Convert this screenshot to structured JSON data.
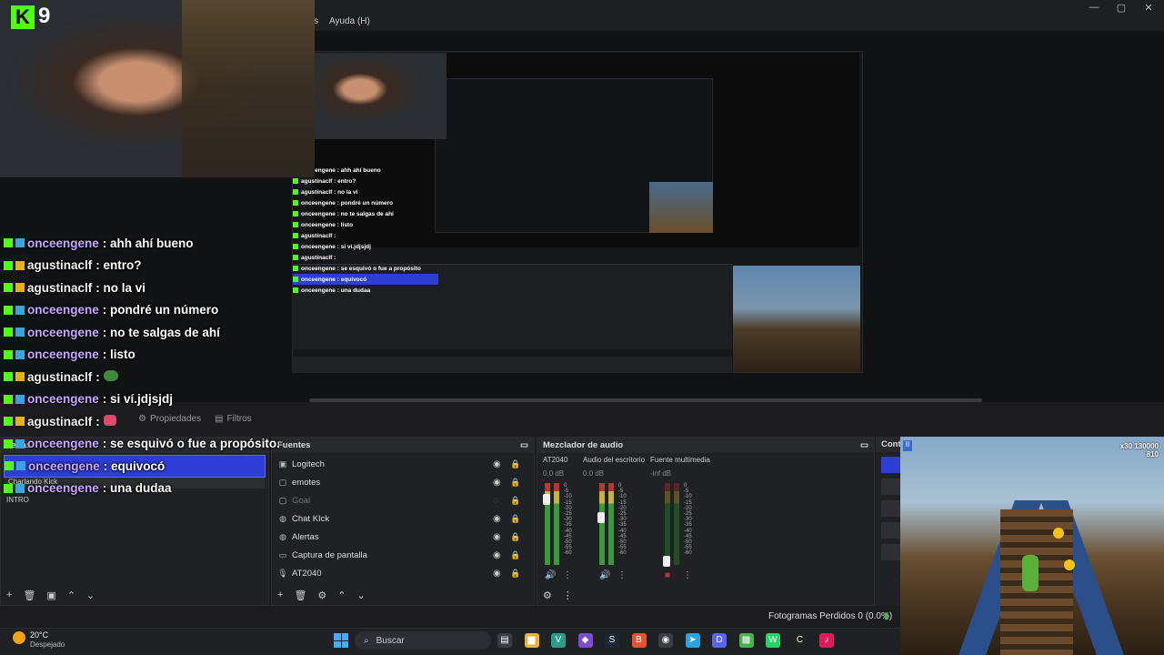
{
  "window": {
    "menu_help": "Ayuda (H)",
    "menu_partial": "s",
    "controls": [
      "—",
      "▢",
      "✕"
    ]
  },
  "overlay": {
    "kick_badge": "K",
    "viewer_count": "9"
  },
  "chat": [
    {
      "user": "onceengene",
      "message": "ahh ahí bueno",
      "badge": "sub",
      "highlight": false
    },
    {
      "user": "agustinaclf",
      "message": "entro?",
      "badge": "crown",
      "highlight": false
    },
    {
      "user": "agustinaclf",
      "message": "no la vi",
      "badge": "crown",
      "highlight": false
    },
    {
      "user": "onceengene",
      "message": "pondré un número",
      "badge": "sub",
      "highlight": false
    },
    {
      "user": "onceengene",
      "message": "no te salgas de ahí",
      "badge": "sub",
      "highlight": false
    },
    {
      "user": "onceengene",
      "message": "listo",
      "badge": "sub",
      "highlight": false
    },
    {
      "user": "agustinaclf",
      "message": "",
      "badge": "crown",
      "highlight": false
    },
    {
      "user": "onceengene",
      "message": "si ví.jdjsjdj",
      "badge": "sub",
      "highlight": false
    },
    {
      "user": "agustinaclf",
      "message": "",
      "badge": "crown",
      "highlight": false
    },
    {
      "user": "onceengene",
      "message": "se esquivó o fue a propósito.",
      "badge": "sub",
      "highlight": false
    },
    {
      "user": "onceengene",
      "message": "equivocó",
      "badge": "sub",
      "highlight": true
    },
    {
      "user": "onceengene",
      "message": "una dudaa",
      "badge": "sub",
      "highlight": false
    }
  ],
  "preview_chat": [
    {
      "text": "onceengene : ahh ahí bueno",
      "highlight": false
    },
    {
      "text": "agustinaclf : entro?",
      "highlight": false
    },
    {
      "text": "agustinaclf : no la vi",
      "highlight": false
    },
    {
      "text": "onceengene : pondré un número",
      "highlight": false
    },
    {
      "text": "onceengene : no te salgas de ahí",
      "highlight": false
    },
    {
      "text": "onceengene : listo",
      "highlight": false
    },
    {
      "text": "agustinaclf :",
      "highlight": false
    },
    {
      "text": "onceengene : si ví.jdjsjdj",
      "highlight": false
    },
    {
      "text": "agustinaclf :",
      "highlight": false
    },
    {
      "text": "onceengene : se esquivó o fue a propósito",
      "highlight": false
    },
    {
      "text": "onceengene : equivocó",
      "highlight": true
    },
    {
      "text": "onceengene : una dudaa",
      "highlight": false
    }
  ],
  "dock_tabs": {
    "properties": "Propiedades",
    "filters": "Filtros"
  },
  "scenes": {
    "title_partial": "cenas",
    "items": [
      "Charlando Kick",
      "INTRO"
    ],
    "footer_buttons": [
      "+",
      "🗑",
      "▣",
      "⌃",
      "⌄"
    ]
  },
  "sources": {
    "title": "Fuentes",
    "items": [
      {
        "name": "Logitech",
        "icon": "camera-icon",
        "glyph": "▣",
        "visible": true
      },
      {
        "name": "emotes",
        "icon": "window-icon",
        "glyph": "▢",
        "visible": true
      },
      {
        "name": "Goal",
        "icon": "window-icon",
        "glyph": "▢",
        "visible": false
      },
      {
        "name": "Chat KIck",
        "icon": "browser-icon",
        "glyph": "◍",
        "visible": true
      },
      {
        "name": "Alertas",
        "icon": "browser-icon",
        "glyph": "◍",
        "visible": true
      },
      {
        "name": "Captura de pantalla",
        "icon": "monitor-icon",
        "glyph": "▭",
        "visible": true
      },
      {
        "name": "AT2040",
        "icon": "mic-icon",
        "glyph": "🎙",
        "visible": true
      }
    ],
    "footer_buttons": [
      "+",
      "🗑",
      "⚙",
      "⌃",
      "⌄"
    ]
  },
  "mixer": {
    "title": "Mezclador de audio",
    "channels": [
      {
        "name": "AT2040",
        "db": "0.0 dB",
        "level": 0.85
      },
      {
        "name": "Audio del escritorio",
        "db": "0.0 dB",
        "level": 0.6
      },
      {
        "name": "Fuente multimedia",
        "db": "-inf dB",
        "level": 0.0
      }
    ],
    "ticks": [
      "0",
      "-5",
      "-10",
      "-15",
      "-20",
      "-25",
      "-30",
      "-35",
      "-40",
      "-45",
      "-50",
      "-55",
      "-60"
    ]
  },
  "controls_panel": {
    "title_partial": "Cont"
  },
  "status": {
    "dropped_frames": "Fotogramas Perdidos 0 (0.0%)"
  },
  "game": {
    "hud_score": "130000",
    "hud_multiplier": "x30",
    "hud_coins": "810"
  },
  "taskbar": {
    "weather_temp": "20°C",
    "weather_desc": "Despejado",
    "search_label": "Buscar",
    "apps": [
      {
        "name": "file-explorer-icon",
        "glyph": "▤",
        "color": "#3a3d44"
      },
      {
        "name": "folder-icon",
        "glyph": "▆",
        "color": "#e8b33a"
      },
      {
        "name": "vs-code-icon",
        "glyph": "V",
        "color": "#2a9d8f"
      },
      {
        "name": "obsidian-icon",
        "glyph": "◆",
        "color": "#7c4dd3"
      },
      {
        "name": "steam-icon",
        "glyph": "S",
        "color": "#1b2838"
      },
      {
        "name": "brave-icon",
        "glyph": "B",
        "color": "#e8522e"
      },
      {
        "name": "obs-icon",
        "glyph": "◉",
        "color": "#3a3d44"
      },
      {
        "name": "telegram-icon",
        "glyph": "➤",
        "color": "#2aa3e0"
      },
      {
        "name": "discord-icon",
        "glyph": "D",
        "color": "#5865f2"
      },
      {
        "name": "minecraft-icon",
        "glyph": "▩",
        "color": "#4caf50"
      },
      {
        "name": "whatsapp-icon",
        "glyph": "W",
        "color": "#25d366"
      },
      {
        "name": "capcut-icon",
        "glyph": "C",
        "color": "#222"
      },
      {
        "name": "tiktok-icon",
        "glyph": "♪",
        "color": "#e01a5b"
      }
    ]
  }
}
